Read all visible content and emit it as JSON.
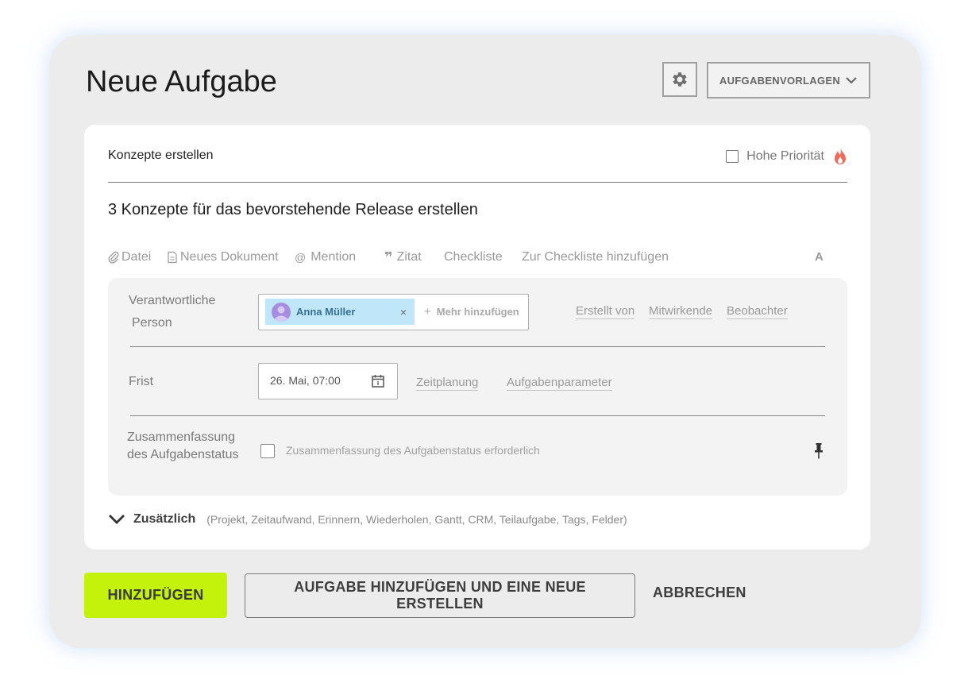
{
  "dialog": {
    "title": "Neue Aufgabe",
    "settings_icon": "gear-icon",
    "templates_label": "AUFGABENVORLAGEN"
  },
  "task": {
    "name": "Konzepte erstellen",
    "high_priority_label": "Hohe Priorität",
    "priority_icon": "flame-icon",
    "description": "3 Konzepte für das bevorstehende Release erstellen"
  },
  "toolbar": {
    "file": "Datei",
    "new_document": "Neues Dokument",
    "mention": "Mention",
    "quote": "Zitat",
    "checklist": "Checkliste",
    "add_to_checklist": "Zur Checkliste hinzufügen",
    "format": "A"
  },
  "responsible": {
    "label_line1": "Verantwortliche",
    "label_line2": "Person",
    "assignee": "Anna Müller",
    "remove": "×",
    "add_more": "Mehr hinzufügen",
    "links": [
      "Erstellt von",
      "Mitwirkende",
      "Beobachter"
    ]
  },
  "deadline": {
    "label": "Frist",
    "value": "26. Mai, 07:00",
    "links": [
      "Zeitplanung",
      "Aufgabenparameter"
    ]
  },
  "summary": {
    "label_line1": "Zusammenfassung",
    "label_line2": "des Aufgabenstatus",
    "checkbox_label": "Zusammenfassung des Aufgabenstatus erforderlich"
  },
  "additional": {
    "label": "Zusätzlich",
    "hint": "(Projekt, Zeitaufwand, Erinnern, Wiederholen, Gantt, CRM, Teilaufgabe, Tags, Felder)"
  },
  "actions": {
    "add": "HINZUFÜGEN",
    "add_and_new": "AUFGABE HINZUFÜGEN UND EINE NEUE ERSTELLEN",
    "cancel": "ABBRECHEN"
  },
  "colors": {
    "accent": "#c4f20a",
    "chip": "#bfe7f9",
    "flame": "#f06a5a"
  }
}
